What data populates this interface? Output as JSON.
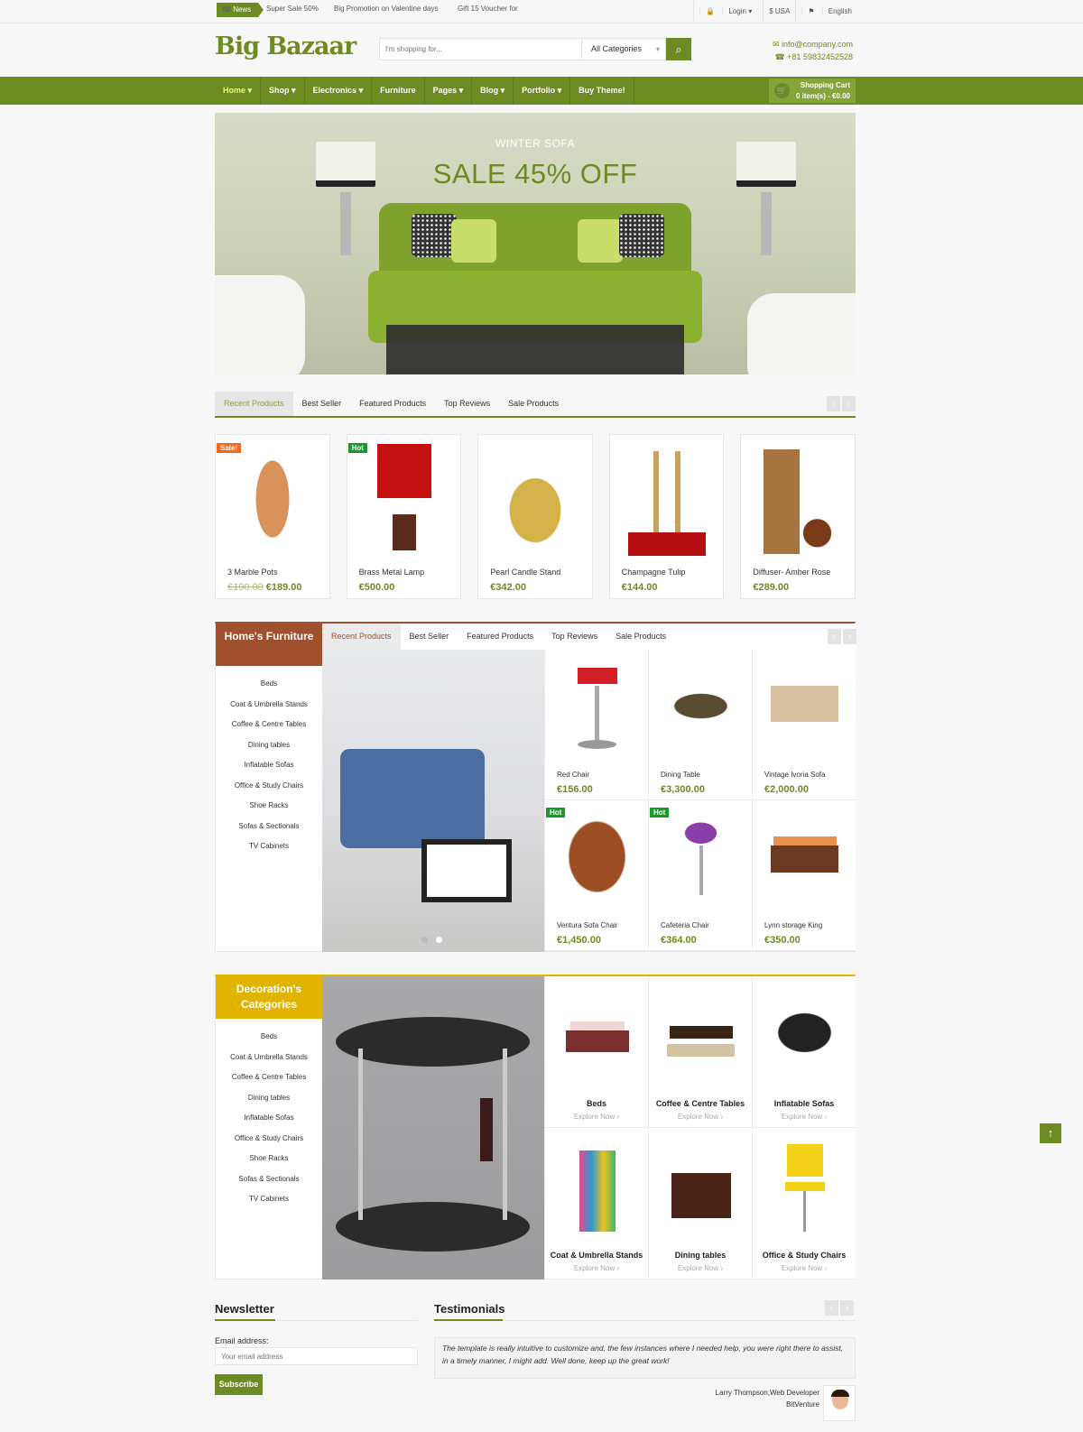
{
  "topbar": {
    "news_label": "News",
    "ticker": [
      "Super Sale 50%",
      "Big Promotion on Valentine days",
      "Gift 15 Voucher for"
    ],
    "login": "Login ▾",
    "currency": "$ USA",
    "language": "English"
  },
  "header": {
    "logo": "Big Bazaar",
    "search_placeholder": "I'm shopping for...",
    "category_select": "All Categories",
    "email": "info@company.com",
    "phone": "+81 59832452528"
  },
  "nav": {
    "items": [
      "Home ▾",
      "Shop ▾",
      "Electronics ▾",
      "Furniture",
      "Pages ▾",
      "Blog ▾",
      "Portfolio ▾",
      "Buy Theme!"
    ],
    "cart_title": "Shopping Cart",
    "cart_summary": "0 item(s) - €0.00"
  },
  "hero": {
    "subtitle": "WINTER SOFA",
    "title": "SALE 45% OFF"
  },
  "product_tabs": [
    "Recent Products",
    "Best Seller",
    "Featured Products",
    "Top Reviews",
    "Sale Products"
  ],
  "products": [
    {
      "name": "3 Marble Pots",
      "old_price": "€190.00",
      "price": "€189.00",
      "badge": "Sale!"
    },
    {
      "name": "Brass Metal Lamp",
      "old_price": "",
      "price": "€500.00",
      "badge": "Hot"
    },
    {
      "name": "Pearl Candle Stand",
      "old_price": "",
      "price": "€342.00",
      "badge": ""
    },
    {
      "name": "Champagne Tulip",
      "old_price": "",
      "price": "€144.00",
      "badge": ""
    },
    {
      "name": "Diffuser- Amber Rose",
      "old_price": "",
      "price": "€289.00",
      "badge": ""
    }
  ],
  "home_furniture": {
    "title": "Home's Furniture",
    "color": "#a0502c",
    "categories": [
      "Beds",
      "Coat & Umbrella Stands",
      "Coffee & Centre Tables",
      "Dining tables",
      "Inflatable Sofas",
      "Office & Study Chairs",
      "Shoe Racks",
      "Sofas & Sectionals",
      "TV Cabinets"
    ],
    "tabs": [
      "Recent Products",
      "Best Seller",
      "Featured Products",
      "Top Reviews",
      "Sale Products"
    ],
    "products": [
      {
        "name": "Red Chair",
        "price": "€156.00",
        "badge": ""
      },
      {
        "name": "Dining Table",
        "price": "€3,300.00",
        "badge": ""
      },
      {
        "name": "Vintage Ivoria Sofa",
        "price": "€2,000.00",
        "badge": ""
      },
      {
        "name": "Ventura Sofa Chair",
        "price": "€1,450.00",
        "badge": "Hot"
      },
      {
        "name": "Cafeteria Chair",
        "price": "€364.00",
        "badge": "Hot"
      },
      {
        "name": "Lynn storage King",
        "price": "€350.00",
        "badge": ""
      }
    ]
  },
  "decoration": {
    "title": "Decoration's Categories",
    "color": "#e0b400",
    "categories": [
      "Beds",
      "Coat & Umbrella Stands",
      "Coffee & Centre Tables",
      "Dining tables",
      "Inflatable Sofas",
      "Office & Study Chairs",
      "Shoe Racks",
      "Sofas & Sectionals",
      "TV Cabinets"
    ],
    "tiles": [
      {
        "name": "Beds",
        "link": "Explore Now ›"
      },
      {
        "name": "Coffee & Centre Tables",
        "link": "Explore Now ›"
      },
      {
        "name": "Inflatable Sofas",
        "link": "Explore Now ›"
      },
      {
        "name": "Coat & Umbrella Stands",
        "link": "Explore Now ›"
      },
      {
        "name": "Dining tables",
        "link": "Explore Now ›"
      },
      {
        "name": "Office & Study Chairs",
        "link": "Explore Now ›"
      }
    ]
  },
  "newsletter": {
    "title": "Newsletter",
    "label": "Email address:",
    "placeholder": "Your email address",
    "button": "Subscribe"
  },
  "testimonials": {
    "title": "Testimonials",
    "quote": "The template is really intuitive to customize and, the few instances where I needed help, you were right there to assist, in a timely manner, I might add. Well done, keep up the great work!",
    "author": "Larry Thompson,Web Developer",
    "company": "BitVenture"
  },
  "brand_color": "#6e8a23"
}
